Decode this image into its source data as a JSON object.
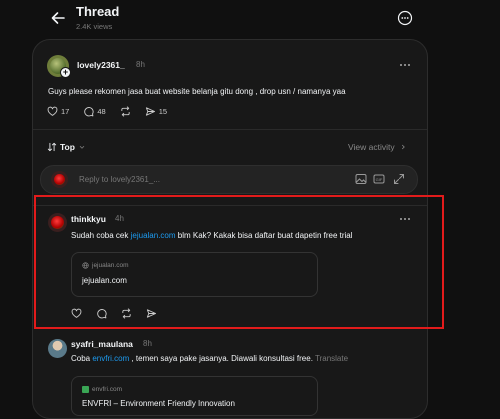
{
  "header": {
    "title": "Thread",
    "views": "2.4K views"
  },
  "op": {
    "username": "lovely2361_",
    "time": "8h",
    "text": "Guys please rekomen jasa buat website belanja gitu dong , drop usn / namanya yaa",
    "likes": "17",
    "comments": "48",
    "shares": "15"
  },
  "sort": {
    "label": "Top",
    "view_activity": "View activity"
  },
  "reply": {
    "placeholder": "Reply to lovely2361_..."
  },
  "replies": [
    {
      "username": "thinkkyu",
      "time": "4h",
      "text_before": "Sudah coba cek ",
      "link": "jejualan.com",
      "text_after": " blm Kak? Kakak bisa daftar buat dapetin free trial",
      "preview_domain": "jejualan.com",
      "preview_title": "jejualan.com"
    },
    {
      "username": "syafri_maulana",
      "time": "8h",
      "text_before": "Coba ",
      "link": "envfri.com",
      "text_after": " , temen saya pake jasanya. Diawali konsultasi free.",
      "translate": "Translate",
      "preview_domain": "envfri.com",
      "preview_title": "ENVFRI – Environment Friendly Innovation"
    }
  ],
  "colors": {
    "background": "#101010",
    "card": "#181818",
    "link": "#1d9bf0",
    "highlight": "#e21b1b"
  }
}
